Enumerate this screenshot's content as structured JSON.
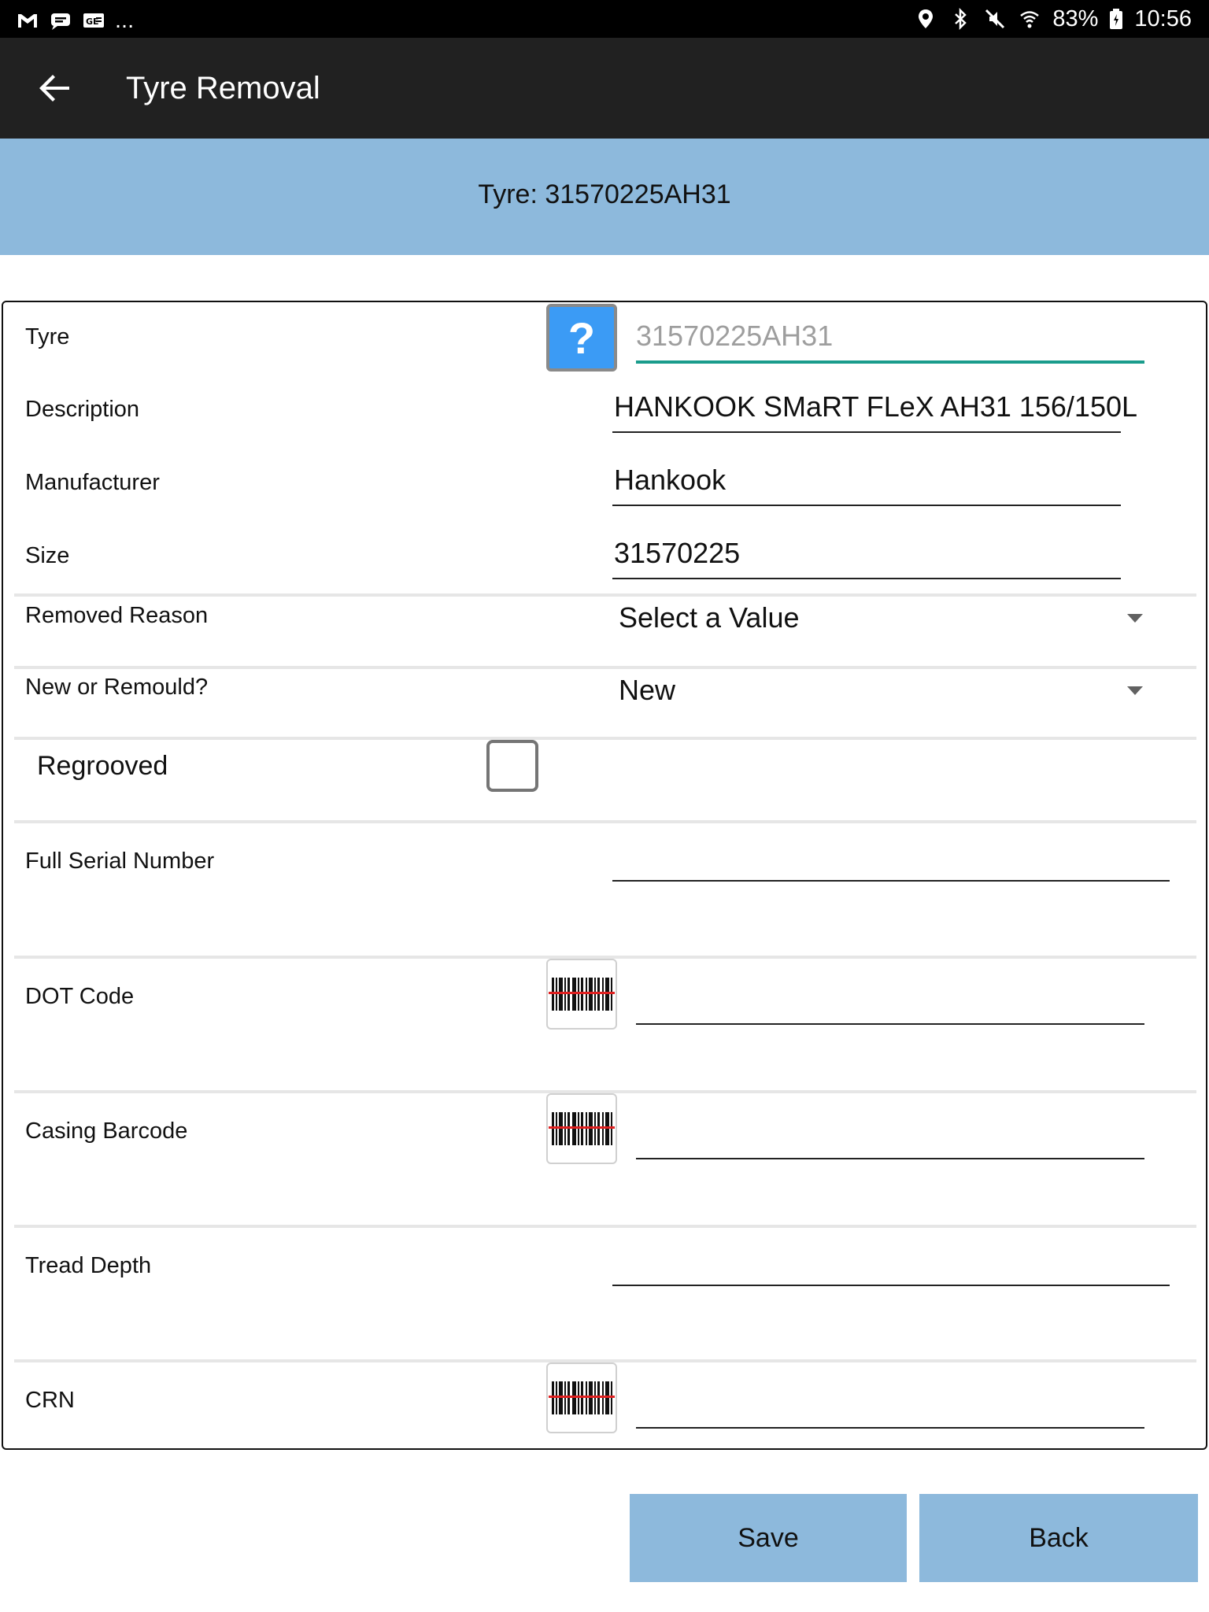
{
  "status_bar": {
    "left_icons": [
      "gmail-icon",
      "messages-icon",
      "news-icon"
    ],
    "more": "...",
    "right_icons": [
      "location-icon",
      "bluetooth-icon",
      "mute-icon",
      "wifi-icon",
      "battery-icon"
    ],
    "battery": "83%",
    "time": "10:56"
  },
  "app_bar": {
    "title": "Tyre Removal"
  },
  "header": {
    "text": "Tyre: 31570225AH31"
  },
  "form": {
    "tyre": {
      "label": "Tyre",
      "value": "31570225AH31"
    },
    "description": {
      "label": "Description",
      "value": "HANKOOK SMaRT FLeX AH31 156/150L"
    },
    "manufacturer": {
      "label": "Manufacturer",
      "value": "Hankook"
    },
    "size": {
      "label": "Size",
      "value": "31570225"
    },
    "removed_reason": {
      "label": "Removed Reason",
      "value": "Select a Value"
    },
    "new_or_remould": {
      "label": "New or Remould?",
      "value": "New"
    },
    "regrooved": {
      "label": "Regrooved",
      "checked": false
    },
    "full_serial_number": {
      "label": "Full Serial Number",
      "value": ""
    },
    "dot_code": {
      "label": "DOT Code",
      "value": ""
    },
    "casing_barcode": {
      "label": "Casing Barcode",
      "value": ""
    },
    "tread_depth": {
      "label": "Tread Depth",
      "value": ""
    },
    "crn": {
      "label": "CRN",
      "value": ""
    }
  },
  "buttons": {
    "save": "Save",
    "back": "Back"
  },
  "colors": {
    "header_band": "#8db9dc",
    "app_bar": "#212121",
    "help_button": "#3b9bf5",
    "tyre_underline": "#1a9c8c"
  }
}
